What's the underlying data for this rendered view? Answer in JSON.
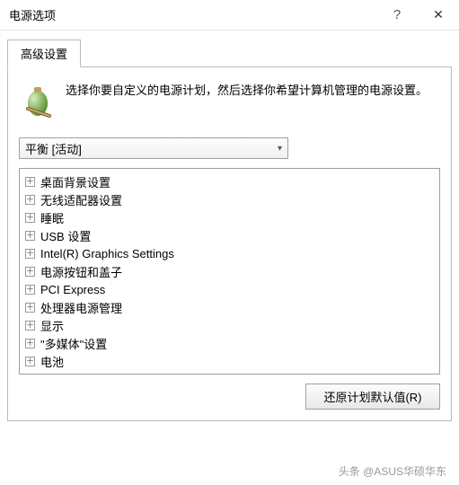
{
  "titlebar": {
    "title": "电源选项",
    "help": "?",
    "close": "✕"
  },
  "tabs": {
    "advanced": "高级设置"
  },
  "info": {
    "text": "选择你要自定义的电源计划，然后选择你希望计算机管理的电源设置。"
  },
  "plan": {
    "selected": "平衡 [活动]"
  },
  "tree": {
    "items": [
      {
        "label": "桌面背景设置"
      },
      {
        "label": "无线适配器设置"
      },
      {
        "label": "睡眠"
      },
      {
        "label": "USB 设置"
      },
      {
        "label": "Intel(R) Graphics Settings"
      },
      {
        "label": "电源按钮和盖子"
      },
      {
        "label": "PCI Express"
      },
      {
        "label": "处理器电源管理"
      },
      {
        "label": "显示"
      },
      {
        "label": "\"多媒体\"设置"
      },
      {
        "label": "电池"
      }
    ]
  },
  "buttons": {
    "restore": "还原计划默认值(R)"
  },
  "watermark": "头条 @ASUS华硕华东"
}
